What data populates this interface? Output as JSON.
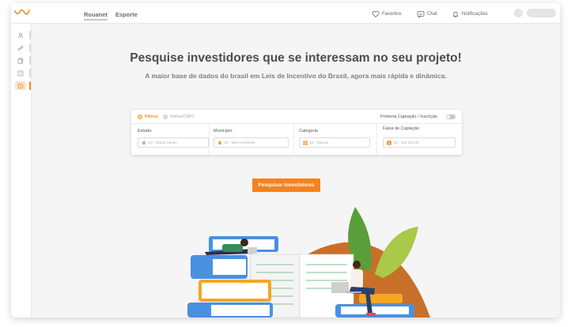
{
  "header": {
    "tabs": [
      {
        "label": "Rouanet",
        "active": true
      },
      {
        "label": "Esporte",
        "active": false
      }
    ],
    "actions": {
      "favorites": "Favoritos",
      "chat": "Chat",
      "notifications": "Notificações"
    }
  },
  "sidebar": {
    "items": [
      {
        "icon": "user-icon",
        "active": false
      },
      {
        "icon": "link-icon",
        "active": false
      },
      {
        "icon": "document-icon",
        "active": false
      },
      {
        "icon": "checklist-icon",
        "active": false
      },
      {
        "icon": "coin-icon",
        "active": true
      }
    ]
  },
  "hero": {
    "title": "Pesquise investidores que se interessam no seu projeto!",
    "subtitle": "A maior base de dados do brasil em Leis de Incentivo do Brasil, agora mais rápida e dinâmica."
  },
  "search_card": {
    "mode_filters": "Filtros",
    "mode_name": "Nome/CNPJ",
    "first_capture_label": "Primeira Captação / Inscrição",
    "first_capture_on": false,
    "fields": {
      "estado": {
        "label": "Estado:",
        "placeholder": "Ex.: Minas Gerais"
      },
      "municipio": {
        "label": "Município",
        "placeholder": "Ex.: Belo Horizonte"
      },
      "categoria": {
        "label": "Categoria",
        "placeholder": "Ex.: Música"
      },
      "faixa": {
        "label": "Faixa de Captação",
        "placeholder": "Ex.: 100.000,00"
      }
    },
    "submit_label": "Pesquisar Investidores"
  },
  "colors": {
    "accent": "#f5821f",
    "text_dark": "#4d4d4d",
    "text_muted": "#808080",
    "book_blue": "#4a90e2",
    "book_orange": "#f5a623",
    "leaf_green": "#7cb342",
    "hill_brown": "#c8702a"
  }
}
